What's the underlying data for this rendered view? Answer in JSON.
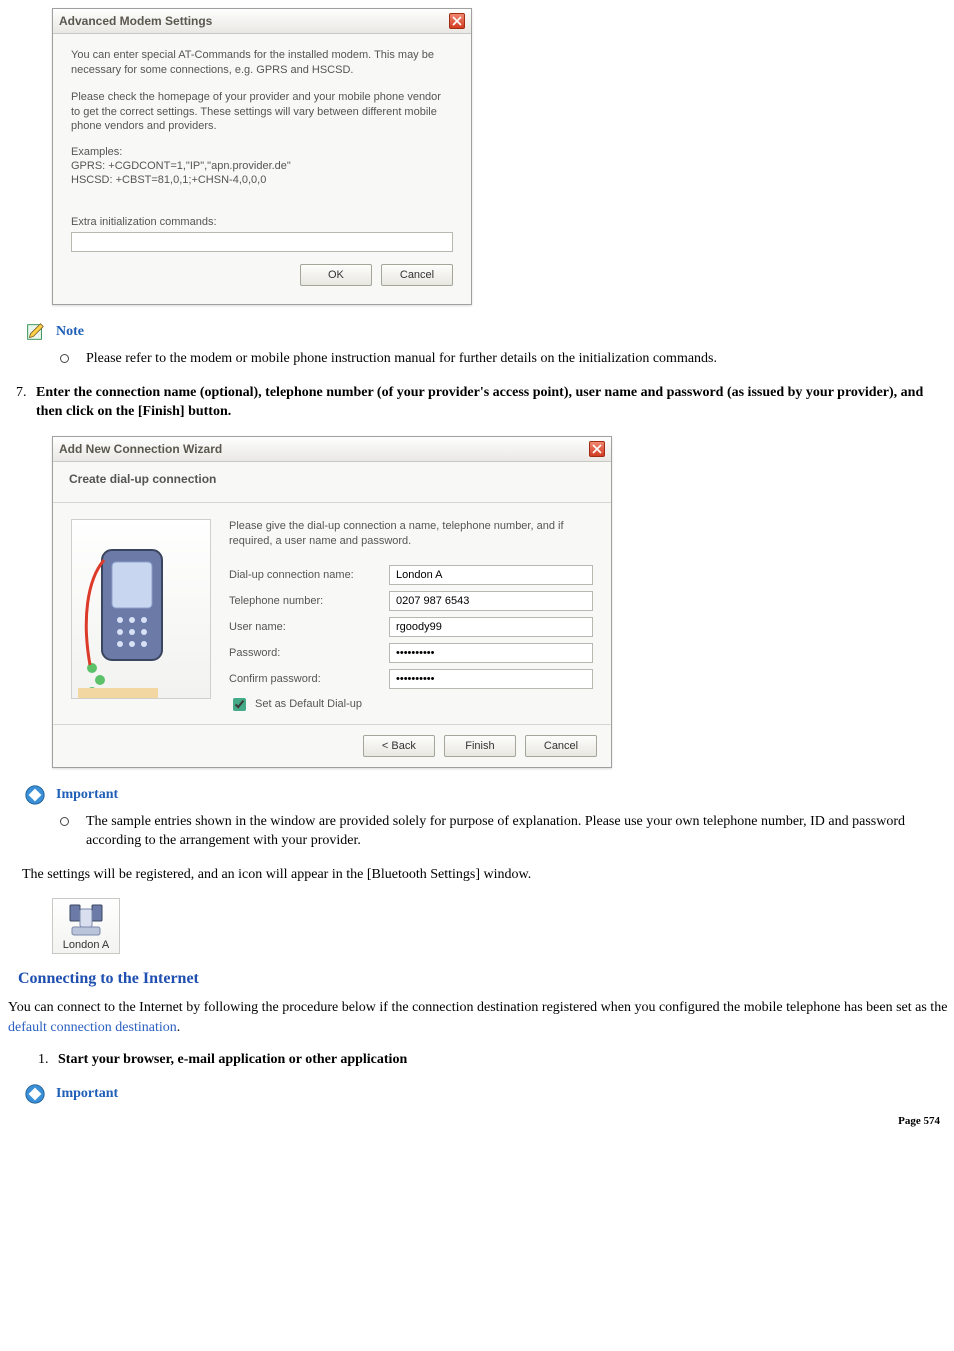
{
  "dialog1": {
    "title": "Advanced Modem Settings",
    "para1": "You can enter special AT-Commands for the installed modem. This may be necessary for some connections, e.g. GPRS and HSCSD.",
    "para2": "Please check the homepage of your provider and your mobile phone vendor to get the correct settings. These settings will vary between different mobile phone vendors and providers.",
    "examples_label": "Examples:",
    "ex1": "GPRS: +CGDCONT=1,\"IP\",\"apn.provider.de\"",
    "ex2": "HSCSD: +CBST=81,0,1;+CHSN-4,0,0,0",
    "extra_label": "Extra initialization commands:",
    "extra_value": "",
    "ok": "OK",
    "cancel": "Cancel"
  },
  "note1": {
    "label": "Note",
    "bullet": "Please refer to the modem or mobile phone instruction manual for further details on the initialization commands."
  },
  "step7": {
    "num": "7.",
    "text": "Enter the connection name (optional), telephone number (of your provider's access point), user name and password (as issued by your provider), and then click on the [Finish] button."
  },
  "dialog2": {
    "title": "Add New Connection Wizard",
    "subtitle": "Create dial-up connection",
    "intro": "Please give the dial-up connection a name, telephone number, and if required, a user name and password.",
    "fields": {
      "conn_label": "Dial-up connection name:",
      "conn_value": "London A",
      "tel_label": "Telephone number:",
      "tel_value": "0207 987 6543",
      "user_label": "User name:",
      "user_value": "rgoody99",
      "pass_label": "Password:",
      "pass_value": "••••••••••",
      "confirm_label": "Confirm password:",
      "confirm_value": "••••••••••",
      "default_label": "Set as Default Dial-up",
      "default_checked": true
    },
    "back": "< Back",
    "finish": "Finish",
    "cancel": "Cancel"
  },
  "important1": {
    "label": "Important",
    "bullet": "The sample entries shown in the window are provided solely for purpose of explanation. Please use your own telephone number, ID and password according to the arrangement with your provider."
  },
  "para_registered": "The settings will be registered, and an icon will appear in the [Bluetooth Settings] window.",
  "bt_icon_label": "London A",
  "section_heading": "Connecting to the Internet",
  "para_connect_pre": "You can connect to the Internet by following the procedure below if the connection destination registered when you configured the mobile telephone has been set as the ",
  "para_connect_link": "default connection destination",
  "para_connect_post": ".",
  "step1": {
    "num": "1.",
    "text": "Start your browser, e-mail application or other application"
  },
  "important2": {
    "label": "Important"
  },
  "footer": "Page  574"
}
